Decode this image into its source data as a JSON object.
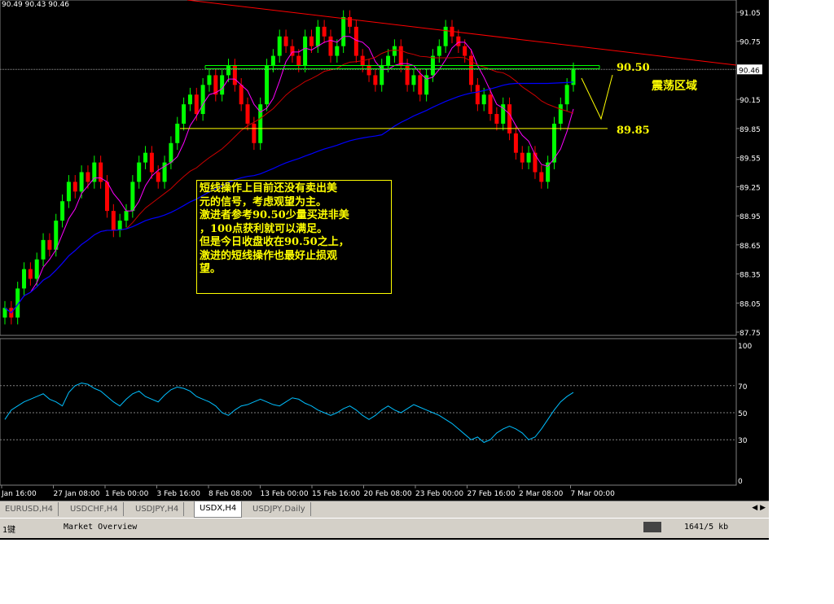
{
  "header": {
    "ohlc": "90.49 90.43 90.46"
  },
  "price_axis": {
    "ticks": [
      "91.05",
      "90.75",
      "90.46",
      "90.15",
      "89.85",
      "89.55",
      "89.25",
      "88.95",
      "88.65",
      "88.35",
      "88.05",
      "87.75"
    ],
    "current": "90.46"
  },
  "rsi_axis": {
    "ticks": [
      "100",
      "70",
      "50",
      "30",
      "0"
    ]
  },
  "time_axis": {
    "ticks": [
      "Jan 16:00",
      "27 Jan 08:00",
      "1 Feb 00:00",
      "3 Feb 16:00",
      "8 Feb 08:00",
      "13 Feb 00:00",
      "15 Feb 16:00",
      "20 Feb 08:00",
      "23 Feb 00:00",
      "27 Feb 16:00",
      "2 Mar 08:00",
      "7 Mar 00:00"
    ]
  },
  "annotations": {
    "level_high": "90.50",
    "level_low": "89.85",
    "zone_label": "震荡区域",
    "note_lines": [
      "短线操作上目前还没有卖出美",
      "元的信号，考虑观望为主。",
      "激进者参考90.50少量买进非美",
      "，100点获利就可以满足。",
      "但是今日收盘收在90.50之上，",
      "激进的短线操作也最好止损观",
      "望。"
    ]
  },
  "tabs": [
    "EURUSD,H4",
    "USDCHF,H4",
    "USDJPY,H4",
    "USDX,H4",
    "USDJPY,Daily"
  ],
  "active_tab": "USDX,H4",
  "status": {
    "left": "1键",
    "market": "Market Overview",
    "traffic": "1641/5 kb"
  },
  "colors": {
    "bull": "#00ff00",
    "bear": "#ff0000",
    "ma_fast": "#ff00ff",
    "ma_mid": "#cc0000",
    "ma_slow": "#0000ff",
    "rsi": "#00bfff",
    "level": "#ffff00",
    "resistance": "#ff0000",
    "range_box": "#00ff00"
  },
  "chart_data": {
    "type": "candlestick",
    "symbol": "USDX",
    "timeframe": "H4",
    "ylim": [
      87.7,
      91.2
    ],
    "closes": [
      88.0,
      87.9,
      88.2,
      88.4,
      88.3,
      88.5,
      88.7,
      88.6,
      88.9,
      89.1,
      89.3,
      89.2,
      89.4,
      89.3,
      89.5,
      89.3,
      89.0,
      88.8,
      88.9,
      89.0,
      89.3,
      89.5,
      89.6,
      89.4,
      89.3,
      89.5,
      89.7,
      89.9,
      90.1,
      90.2,
      90.0,
      90.3,
      90.4,
      90.2,
      90.4,
      90.5,
      90.3,
      90.1,
      89.9,
      89.7,
      90.1,
      90.5,
      90.6,
      90.8,
      90.7,
      90.6,
      90.5,
      90.8,
      90.7,
      90.9,
      90.8,
      90.6,
      90.7,
      91.0,
      90.9,
      90.6,
      90.5,
      90.4,
      90.3,
      90.5,
      90.6,
      90.7,
      90.5,
      90.3,
      90.4,
      90.2,
      90.4,
      90.6,
      90.7,
      90.9,
      90.8,
      90.7,
      90.6,
      90.3,
      90.1,
      90.2,
      90.0,
      89.9,
      90.1,
      89.8,
      89.6,
      89.5,
      89.6,
      89.4,
      89.3,
      89.5,
      89.9,
      90.1,
      90.3,
      90.46
    ],
    "rsi": {
      "levels": [
        70,
        50,
        30
      ],
      "values": [
        45,
        52,
        55,
        58,
        60,
        62,
        64,
        60,
        58,
        55,
        65,
        70,
        72,
        71,
        68,
        66,
        62,
        58,
        55,
        60,
        64,
        66,
        62,
        60,
        58,
        63,
        67,
        69,
        68,
        66,
        62,
        60,
        58,
        55,
        50,
        48,
        52,
        55,
        56,
        58,
        60,
        58,
        56,
        55,
        58,
        61,
        60,
        57,
        55,
        52,
        50,
        48,
        50,
        53,
        55,
        52,
        48,
        45,
        48,
        52,
        55,
        52,
        50,
        53,
        56,
        54,
        52,
        50,
        48,
        45,
        42,
        38,
        34,
        30,
        32,
        28,
        30,
        35,
        38,
        40,
        38,
        35,
        30,
        32,
        38,
        45,
        52,
        58,
        62,
        65
      ]
    },
    "levels": [
      90.5,
      89.85
    ]
  }
}
